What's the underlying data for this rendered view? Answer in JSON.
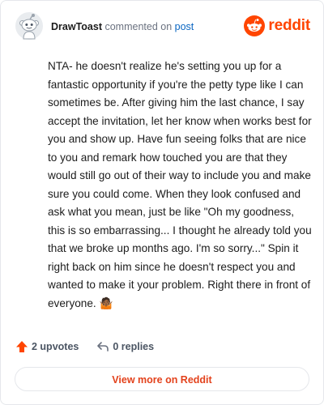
{
  "header": {
    "author": "DrawToast",
    "action": "commented on",
    "post_link": "post",
    "brand": "reddit"
  },
  "comment": {
    "body": "NTA- he doesn't realize he's setting you up for a fantastic opportunity if you're the petty type like I can sometimes be. After giving him the last chance, I say accept the invitation, let her know when works best for you and show up. Have fun seeing folks that are nice to you and remark how touched you are that they would still go out of their way to include you and make sure you could come. When they look confused and ask what you mean, just be like \"Oh my goodness, this is so embarrassing... I thought he already told you that we broke up months ago. I'm so sorry...\" Spin it right back on him since he doesn't respect you and wanted to make it your problem. Right there in front of everyone. 🤷🏾"
  },
  "footer": {
    "upvotes": "2 upvotes",
    "replies": "0 replies"
  },
  "cta": {
    "label": "View more on Reddit"
  },
  "icons": {
    "avatar": "snoo-avatar-icon",
    "brand": "reddit-logo-icon",
    "upvote": "upvote-arrow-icon",
    "reply": "reply-arrow-icon"
  },
  "colors": {
    "brand": "#ff4500",
    "link": "#0a66c2",
    "cta_text": "#e3421c"
  }
}
